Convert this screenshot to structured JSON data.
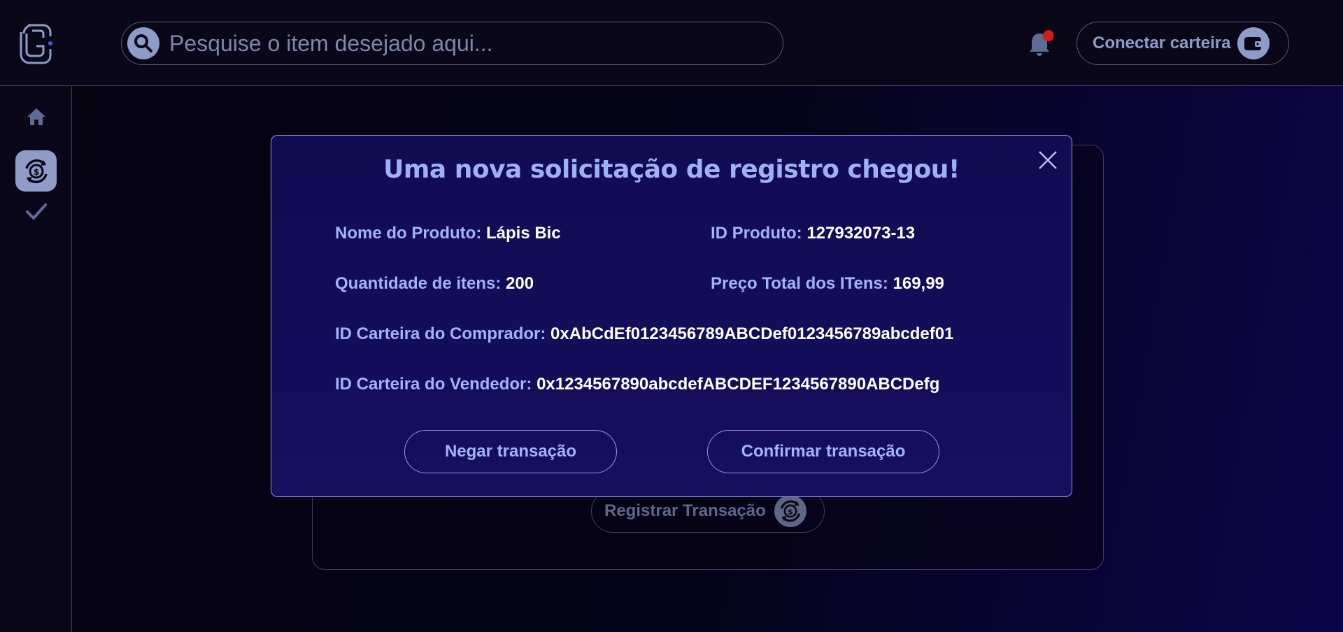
{
  "header": {
    "search_placeholder": "Pesquise o item desejado aqui...",
    "wallet_button_label": "Conectar carteira",
    "notification_badge_color": "#d41a1a"
  },
  "sidebar": {
    "items": [
      {
        "icon": "home-icon"
      },
      {
        "icon": "transaction-cycle-icon",
        "active": true
      },
      {
        "icon": "check-icon"
      }
    ]
  },
  "background_card": {
    "register_button_label": "Registrar Transação"
  },
  "modal": {
    "title": "Uma nova solicitação de registro chegou!",
    "fields": {
      "product_name": {
        "label": "Nome do Produto:",
        "value": "Lápis Bic"
      },
      "product_id": {
        "label": "ID Produto:",
        "value": "127932073-13"
      },
      "quantity": {
        "label": "Quantidade de itens:",
        "value": "200"
      },
      "total_price": {
        "label": "Preço Total dos ITens:",
        "value": "169,99"
      },
      "buyer_wallet": {
        "label": "ID Carteira do Comprador:",
        "value": "0xAbCdEf0123456789ABCDef0123456789abcdef01"
      },
      "seller_wallet": {
        "label": "ID Carteira do Vendedor:",
        "value": "0x1234567890abcdefABCDEF1234567890ABCDefg"
      }
    },
    "deny_button_label": "Negar transação",
    "confirm_button_label": "Confirmar transação"
  },
  "colors": {
    "accent": "#8e9cc7",
    "modal_bg": "#120d55",
    "modal_label": "#a3b3f4"
  }
}
